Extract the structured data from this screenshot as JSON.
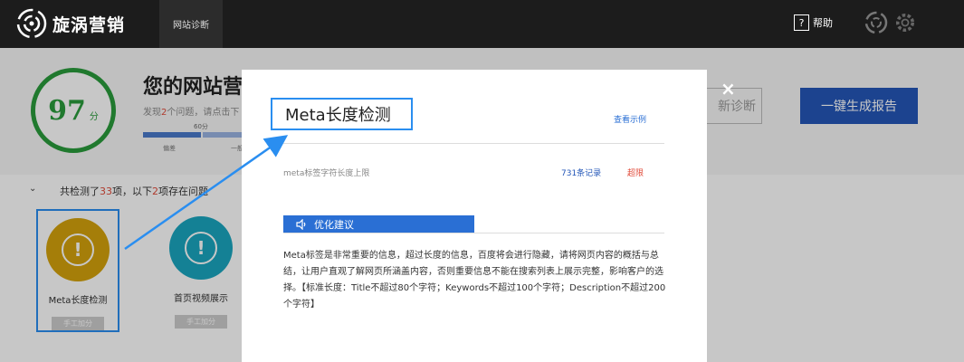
{
  "topbar": {
    "brand": "旋涡营销",
    "nav_tab": "网站诊断",
    "help_label": "帮助",
    "help_glyph": "?"
  },
  "header": {
    "score": "97",
    "score_unit": "分",
    "title": "您的网站营",
    "found_pre": "发现",
    "found_count": "2",
    "found_post": "个问题，请点击下",
    "bar_marker": "60分",
    "bar_label_1": "偏差",
    "bar_label_2": "一般",
    "rediagnose_label": "新诊断",
    "report_label": "一键生成报告"
  },
  "checks": {
    "summary_pre": "共检测了",
    "total": "33",
    "summary_mid": "项，以下",
    "issues": "2",
    "summary_post": "项存在问题",
    "items": [
      {
        "label": "Meta长度检测",
        "tag": "手工加分",
        "color": "#d4a20c"
      },
      {
        "label": "首页视频展示",
        "tag": "手工加分",
        "color": "#1aa6bf"
      }
    ]
  },
  "modal": {
    "title": "Meta长度检测",
    "view_example": "查看示例",
    "row_label": "meta标签字符长度上限",
    "row_count": "731条记录",
    "row_status": "超限",
    "advice_label": "优化建议",
    "advice_text": "Meta标签是非常重要的信息，超过长度的信息，百度将会进行隐藏，请将网页内容的概括与总结，让用户直观了解网页所涵盖内容，否则重要信息不能在搜索列表上展示完整，影响客户的选择。【标准长度：Title不超过80个字符；Keywords不超过100个字符；Description不超过200个字符】",
    "close_glyph": "×"
  },
  "colors": {
    "score_green": "#2a9b3c",
    "accent_blue": "#2a6fd4",
    "alert_red": "#e04b3a"
  }
}
